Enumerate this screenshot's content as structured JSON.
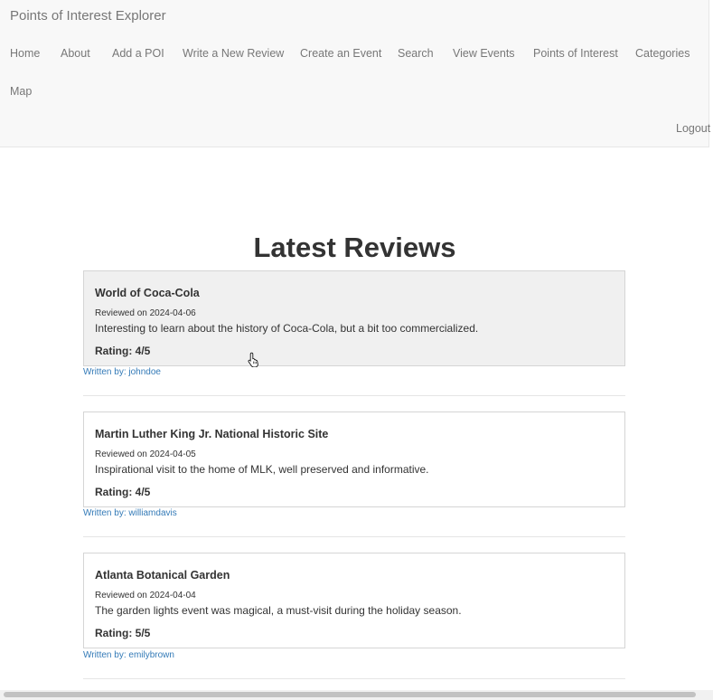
{
  "navbar": {
    "brand": "Points of Interest Explorer",
    "links": [
      "Home",
      "About",
      "Add a POI",
      "Write a New Review",
      "Create an Event",
      "Search",
      "View Events",
      "Points of Interest",
      "Categories",
      "Map"
    ],
    "logout": "Logout"
  },
  "main": {
    "heading": "Latest Reviews",
    "reviews": [
      {
        "poi": "World of Coca-Cola",
        "date": "Reviewed on 2024-04-06",
        "text": "Interesting to learn about the history of Coca-Cola, but a bit too commercialized.",
        "rating": "Rating: 4/5",
        "author": "Written by: johndoe"
      },
      {
        "poi": "Martin Luther King Jr. National Historic Site",
        "date": "Reviewed on 2024-04-05",
        "text": "Inspirational visit to the home of MLK, well preserved and informative.",
        "rating": "Rating: 4/5",
        "author": "Written by: williamdavis"
      },
      {
        "poi": "Atlanta Botanical Garden",
        "date": "Reviewed on 2024-04-04",
        "text": "The garden lights event was magical, a must-visit during the holiday season.",
        "rating": "Rating: 5/5",
        "author": "Written by: emilybrown"
      }
    ]
  },
  "colors": {
    "navbar_bg": "#f8f8f8",
    "link": "#337ab7",
    "card_hover_bg": "#f0f0f0"
  },
  "icons": {
    "cursor": "hand-pointer-icon"
  }
}
